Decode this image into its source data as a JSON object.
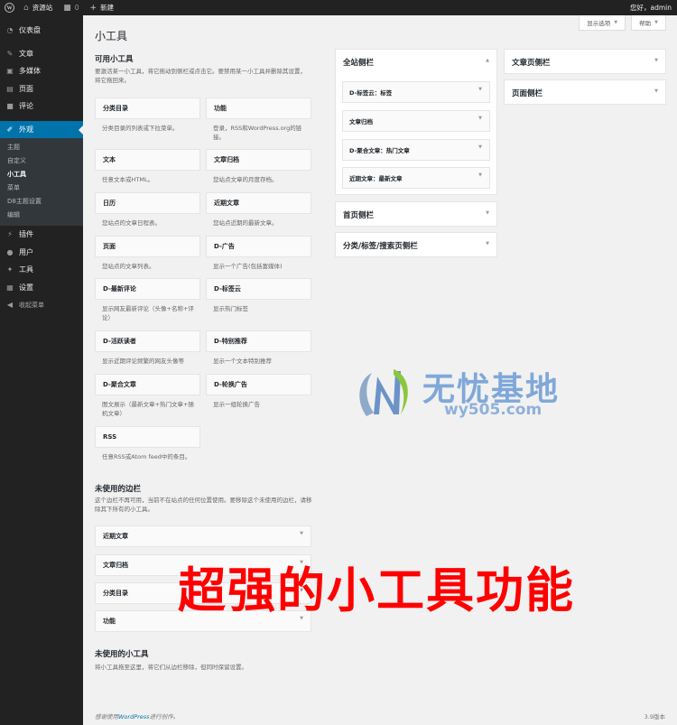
{
  "adminbar": {
    "site_name": "资源站",
    "comments_count": "0",
    "new_label": "新建",
    "greeting": "您好，admin"
  },
  "menu": {
    "dashboard": "仪表盘",
    "posts": "文章",
    "media": "多媒体",
    "pages": "页面",
    "comments": "评论",
    "appearance": "外观",
    "sub": [
      "主题",
      "自定义",
      "小工具",
      "菜单",
      "D8主题设置",
      "编辑"
    ],
    "plugins": "插件",
    "users": "用户",
    "tools": "工具",
    "settings": "设置",
    "collapse": "收起菜单"
  },
  "screen_meta": {
    "options": "显示选项",
    "help": "帮助"
  },
  "page_title": "小工具",
  "available": {
    "heading": "可用小工具",
    "desc": "要激活某一小工具，将它拖动到侧栏或点击它。要禁用某一小工具并删除其设置，将它拖回来。",
    "widgets": [
      {
        "title": "分类目录",
        "desc": "分类目录的列表或下拉菜单。"
      },
      {
        "title": "功能",
        "desc": "登录，RSS和WordPress.org的链接。"
      },
      {
        "title": "文本",
        "desc": "任意文本或HTML。"
      },
      {
        "title": "文章归档",
        "desc": "您站点文章的月度存档。"
      },
      {
        "title": "日历",
        "desc": "您站点的文章日程表。"
      },
      {
        "title": "近期文章",
        "desc": "您站点近期的最新文章。"
      },
      {
        "title": "页面",
        "desc": "您站点的文章列表。"
      },
      {
        "title": "D-广告",
        "desc": "显示一个广告(包括富媒体)"
      },
      {
        "title": "D-最新评论",
        "desc": "显示网友最新评论（头像+名称+评论）"
      },
      {
        "title": "D-标签云",
        "desc": "显示热门标签"
      },
      {
        "title": "D-活跃读者",
        "desc": "显示近期评论频繁的网友头像等"
      },
      {
        "title": "D-特别推荐",
        "desc": "显示一个文本特别推荐"
      },
      {
        "title": "D-聚合文章",
        "desc": "图文展示（最新文章+热门文章+随机文章）"
      },
      {
        "title": "D-轮换广告",
        "desc": "显示一组轮换广告"
      },
      {
        "title": "RSS",
        "desc": "任意RSS或Atom feed中的条目。"
      }
    ]
  },
  "unused_sidebar": {
    "heading": "未使用的边栏",
    "desc": "这个边栏不再可用，当前不在站点的任何位置使用。要移除这个未使用的边栏，请移除其下所有的小工具。",
    "items": [
      "近期文章",
      "文章归档",
      "分类目录",
      "功能"
    ]
  },
  "unused_widgets": {
    "heading": "未使用的小工具",
    "desc": "将小工具拖至这里，将它们从边栏移除，但同时保留设置。"
  },
  "sidebars": {
    "site": {
      "title": "全站侧栏",
      "widgets": [
        "D-标签云：标签",
        "文章归档",
        "D-聚合文章：热门文章",
        "近期文章：最新文章"
      ]
    },
    "home": {
      "title": "首页侧栏"
    },
    "category": {
      "title": "分类/标签/搜索页侧栏"
    },
    "article": {
      "title": "文章页侧栏"
    },
    "page": {
      "title": "页面侧栏"
    }
  },
  "watermark": {
    "text": "无忧基地",
    "url": "wy505.com"
  },
  "overlay_text": "超强的小工具功能",
  "footer": {
    "prefix": "感谢使用",
    "link": "WordPress",
    "suffix": "进行创作。",
    "version": "3.9版本"
  }
}
